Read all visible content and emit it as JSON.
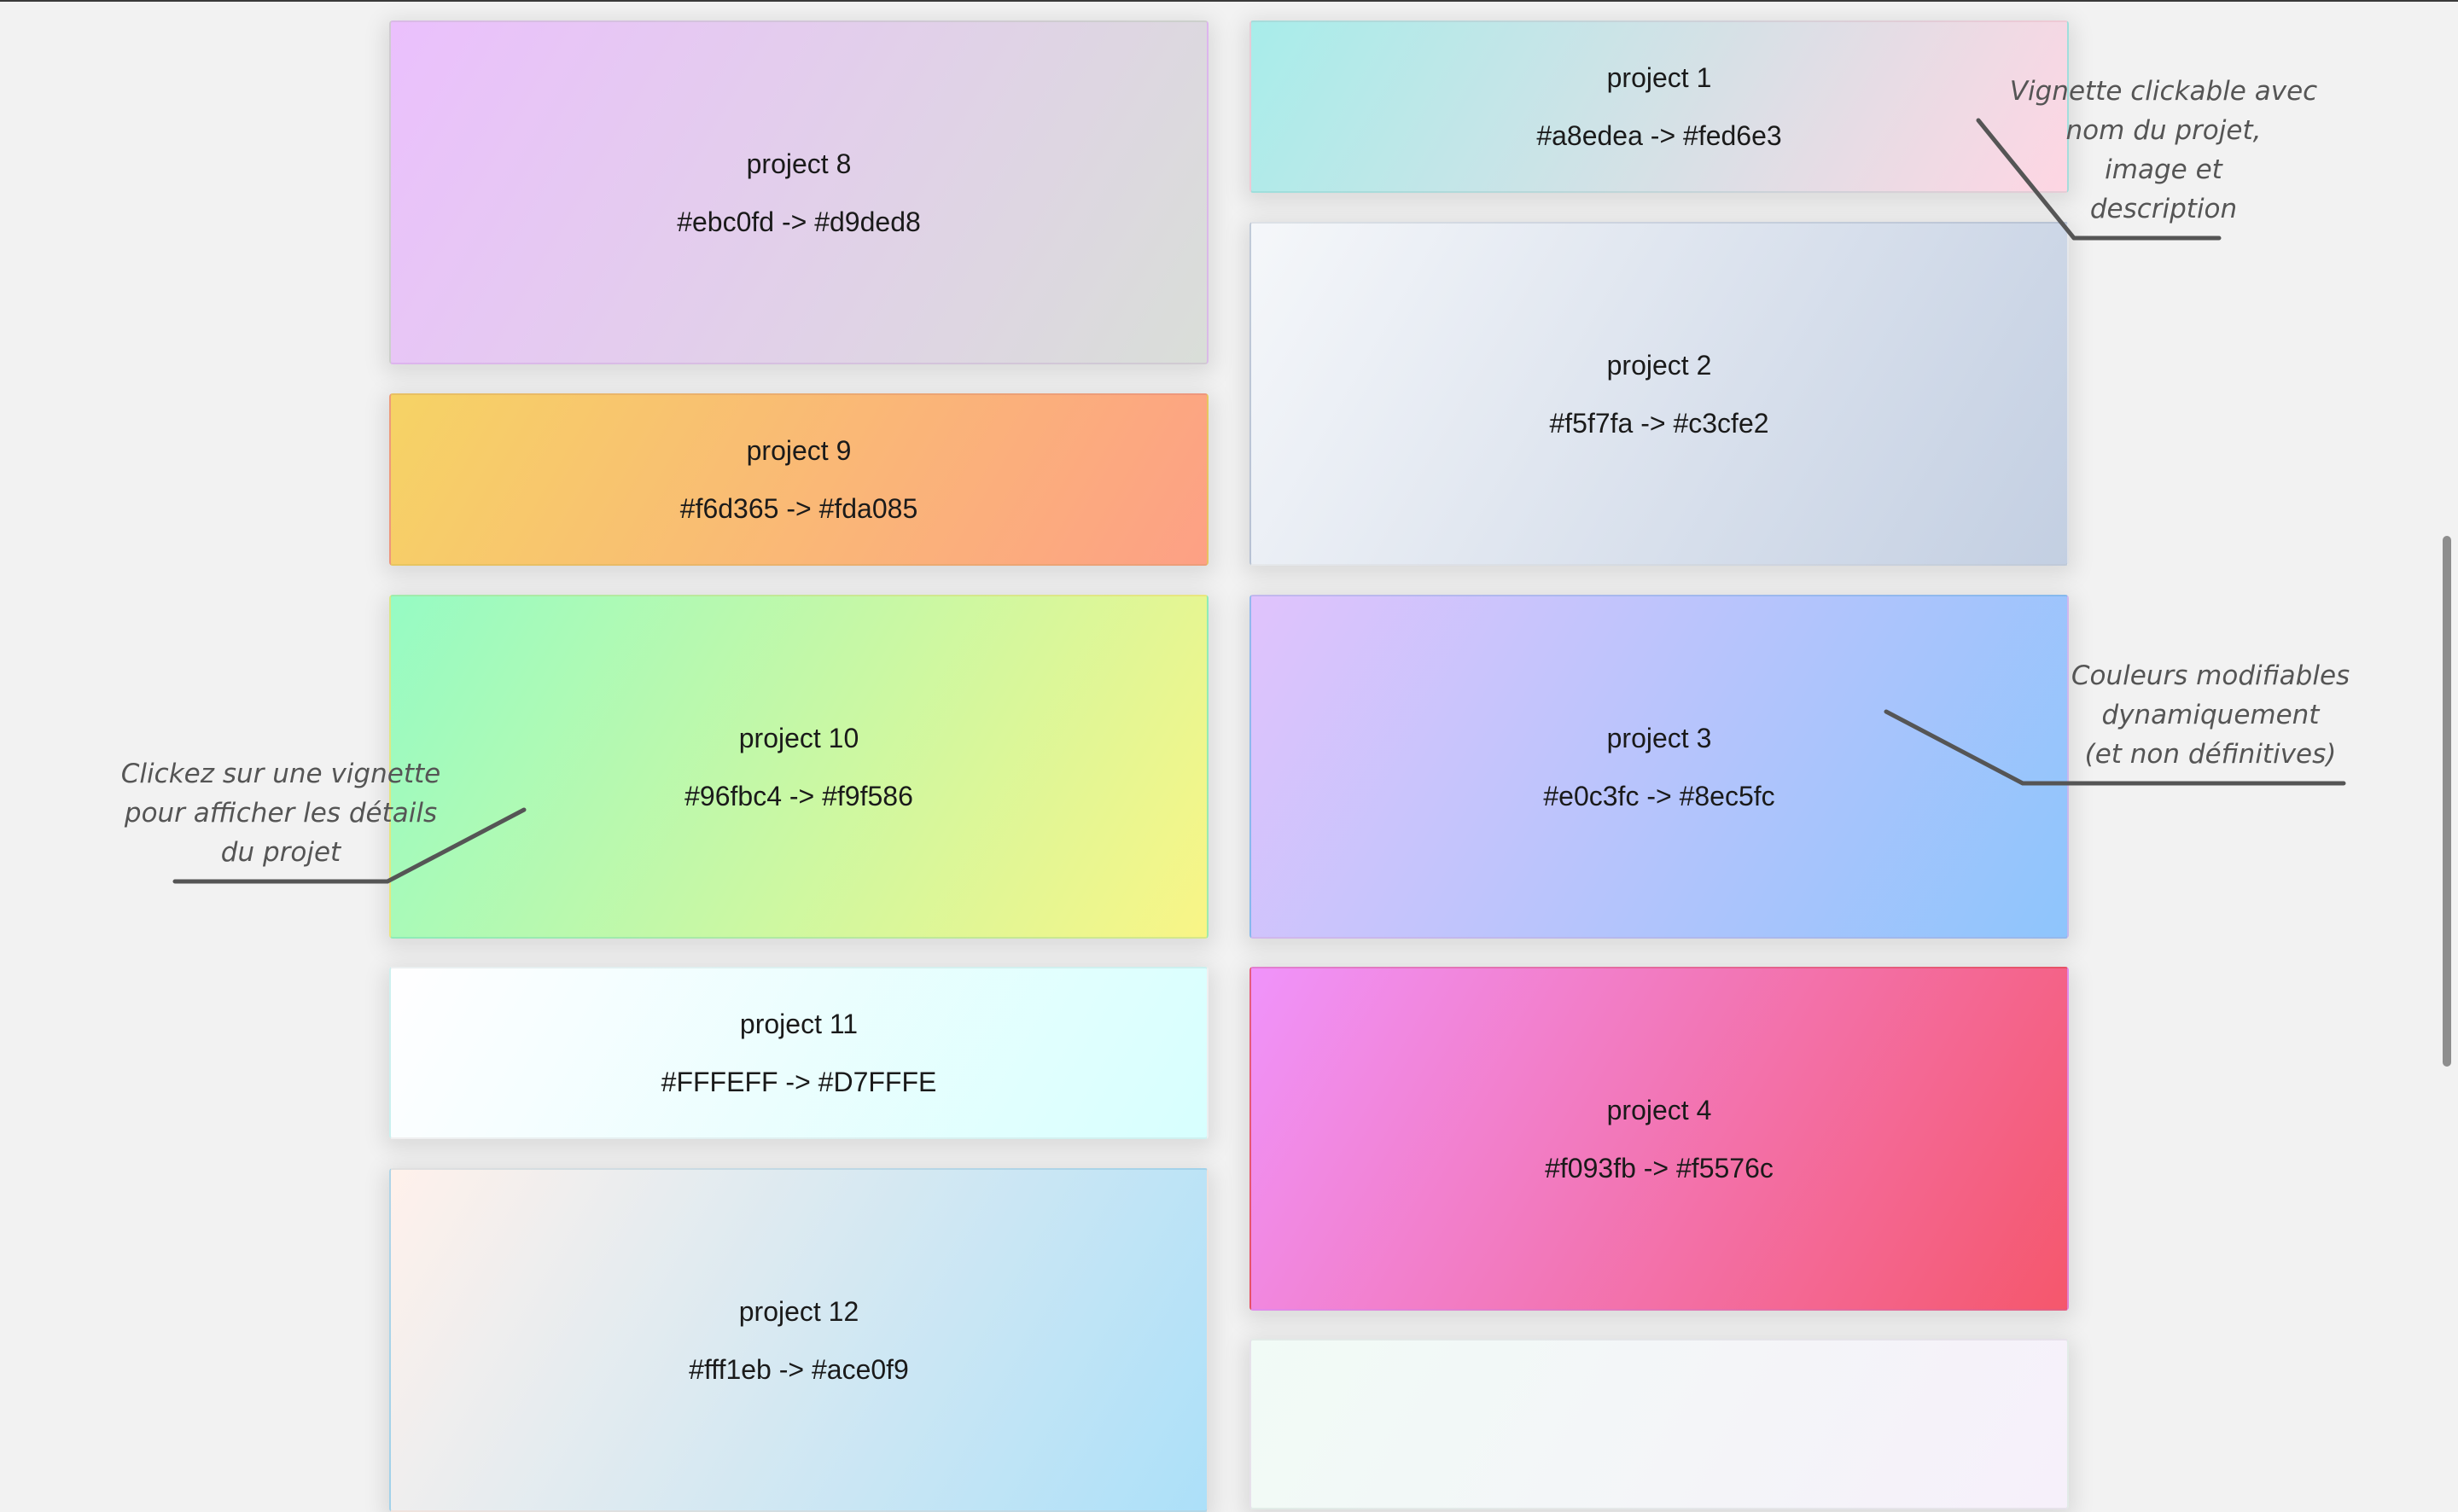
{
  "projects": [
    {
      "name": "project 8",
      "gradient_label": "#ebc0fd -> #d9ded8",
      "color_from": "#ebc0fd",
      "color_to": "#d9ded8"
    },
    {
      "name": "project 9",
      "gradient_label": "#f6d365 -> #fda085",
      "color_from": "#f6d365",
      "color_to": "#fda085"
    },
    {
      "name": "project 10",
      "gradient_label": "#96fbc4 -> #f9f586",
      "color_from": "#96fbc4",
      "color_to": "#f9f586"
    },
    {
      "name": "project 11",
      "gradient_label": "#FFFEFF -> #D7FFFE",
      "color_from": "#FFFEFF",
      "color_to": "#D7FFFE"
    },
    {
      "name": "project 12",
      "gradient_label": "#fff1eb -> #ace0f9",
      "color_from": "#fff1eb",
      "color_to": "#ace0f9"
    },
    {
      "name": "project 1",
      "gradient_label": "#a8edea -> #fed6e3",
      "color_from": "#a8edea",
      "color_to": "#fed6e3"
    },
    {
      "name": "project 2",
      "gradient_label": "#f5f7fa -> #c3cfe2",
      "color_from": "#f5f7fa",
      "color_to": "#c3cfe2"
    },
    {
      "name": "project 3",
      "gradient_label": "#e0c3fc -> #8ec5fc",
      "color_from": "#e0c3fc",
      "color_to": "#8ec5fc"
    },
    {
      "name": "project 4",
      "gradient_label": "#f093fb -> #f5576c",
      "color_from": "#f093fb",
      "color_to": "#f5576c"
    },
    {
      "name": "",
      "gradient_label": "",
      "color_from": "#f1fbf6",
      "color_to": "#f6f0fa"
    }
  ],
  "annotations": {
    "thumbnail": [
      "Vignette clickable avec",
      "nom du projet,",
      "image et",
      "description"
    ],
    "colors": [
      "Couleurs modifiables",
      "dynamiquement",
      "(et non définitives)"
    ],
    "click": [
      "Clickez sur une vignette",
      "pour afficher les détails",
      "du projet"
    ]
  }
}
